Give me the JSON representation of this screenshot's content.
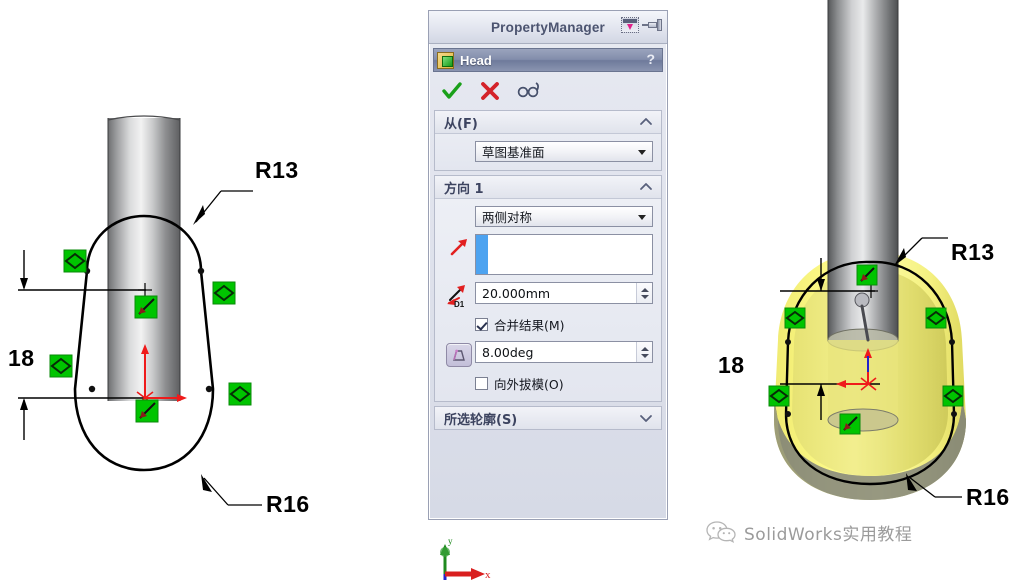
{
  "propertymanager": {
    "title": "PropertyManager",
    "collapse_icon": "collapse-panel-icon",
    "pin_icon": "pushpin-icon",
    "feature": {
      "icon": "extruded-boss-base-icon",
      "name": "Head",
      "help_label": "?"
    },
    "actions": {
      "ok_label": "OK",
      "cancel_label": "Cancel",
      "preview_label": "Preview"
    },
    "groups": [
      {
        "title": "从(F)",
        "collapsed": false,
        "chevron": "chevron-up-icon",
        "start_condition": "草图基准面"
      },
      {
        "title": "方向 1",
        "collapsed": false,
        "chevron": "chevron-up-icon",
        "end_condition": "两侧对称",
        "reverse_direction_icon": "reverse-direction-arrow-icon",
        "selection_value": "",
        "depth_icon": "depth-d1-icon",
        "depth_value": "20.000mm",
        "merge_result_label": "合并结果(M)",
        "merge_result_checked": true,
        "draft_icon": "draft-angle-icon",
        "draft_value": "8.00deg",
        "draft_outward_label": "向外拔模(O)",
        "draft_outward_checked": false
      },
      {
        "title": "所选轮廓(S)",
        "collapsed": true,
        "chevron": "chevron-down-icon"
      }
    ]
  },
  "left_view": {
    "name": "sketch-profile-front-view",
    "labels": {
      "upper_radius": "R13",
      "lower_radius": "R16",
      "height_dimension": "18"
    },
    "colors": {
      "sketch_line": "#000000",
      "constraint_marker": "#00c400",
      "origin_axis": "#ff0000"
    }
  },
  "right_view": {
    "name": "extrude-preview-3d-view",
    "labels": {
      "upper_radius": "R13",
      "lower_radius": "R16",
      "height_dimension": "18"
    },
    "colors": {
      "preview_body": "#fbf870",
      "solid_body": "#9a9a84",
      "shaft_metal": "#9fa0a2"
    }
  },
  "axis_triad": {
    "name": "coordinate-axis-triad",
    "x_label": "x",
    "y_label": "y",
    "x_color": "#d91f1f",
    "y_color": "#1f8a1f",
    "z_color": "#2222cc"
  },
  "watermark": {
    "icon": "wechat-icon",
    "text": "SolidWorks实用教程",
    "color": "#9b9b9b"
  }
}
